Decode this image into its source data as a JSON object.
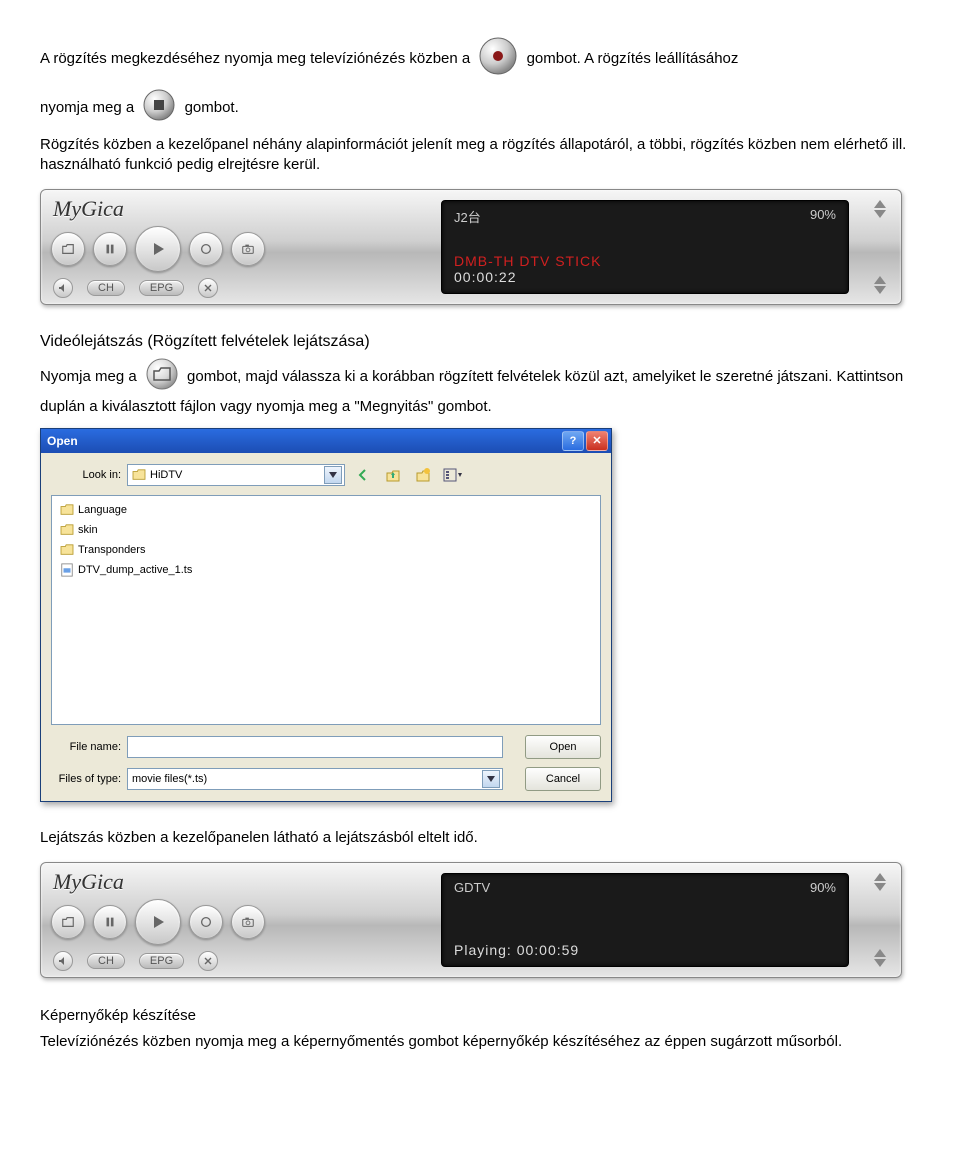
{
  "para1": {
    "a": "A rögzítés megkezdéséhez nyomja meg televíziónézés közben a",
    "b": "gombot. A rögzítés leállításához"
  },
  "para2": {
    "a": "nyomja meg a",
    "b": "gombot."
  },
  "para3": "Rögzítés közben a kezelőpanel néhány alapinformációt jelenít meg a rögzítés állapotáról, a többi, rögzítés közben nem elérhető ill. használható funkció pedig elrejtésre kerül.",
  "panel1": {
    "brand": "MyGica",
    "pill_ch": "CH",
    "pill_epg": "EPG",
    "disp_ch": "J2台",
    "disp_vol": "90%",
    "disp_name": "DMB-TH DTV STICK",
    "disp_time": "00:00:22"
  },
  "section_video_title": "Videólejátszás (Rögzített felvételek lejátszása)",
  "para4": {
    "a": "Nyomja meg a",
    "b": "gombot, majd válassza ki a korábban rögzített felvételek közül azt, amelyiket le szeretné játszani. Kattintson duplán a kiválasztott fájlon vagy nyomja meg a \"Megnyitás\" gombot."
  },
  "opendlg": {
    "title": "Open",
    "lookin_label": "Look in:",
    "lookin_value": "HiDTV",
    "files": [
      "Language",
      "skin",
      "Transponders",
      "DTV_dump_active_1.ts"
    ],
    "filename_label": "File name:",
    "filename_value": "",
    "filetype_label": "Files of type:",
    "filetype_value": "movie files(*.ts)",
    "open_btn": "Open",
    "cancel_btn": "Cancel"
  },
  "para5": "Lejátszás közben a kezelőpanelen látható a lejátszásból eltelt idő.",
  "panel2": {
    "brand": "MyGica",
    "pill_ch": "CH",
    "pill_epg": "EPG",
    "disp_ch": "GDTV",
    "disp_vol": "90%",
    "disp_play": "Playing: 00:00:59"
  },
  "section_screenshot_title": "Képernyőkép készítése",
  "para6": "Televíziónézés közben nyomja meg a képernyőmentés gombot képernyőkép készítéséhez az éppen sugárzott műsorból."
}
